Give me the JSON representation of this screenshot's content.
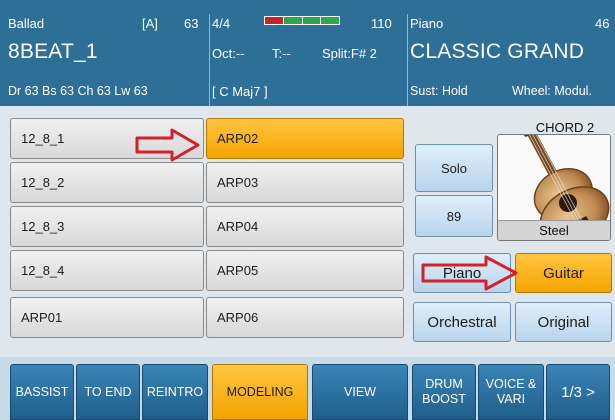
{
  "style_panel": {
    "category": "Ballad",
    "variation": "[A]",
    "number": "63",
    "name": "8BEAT_1",
    "volumes": "Dr 63  Bs 63  Ch 63  Lw 63"
  },
  "mid_panel": {
    "time_signature": "4/4",
    "tempo": "110",
    "octave": "Oct:--",
    "transpose": "T:--",
    "split": "Split:F# 2",
    "chord": "[ C Maj7 ]",
    "meter_colors": [
      "#c9232b",
      "#2aa84a",
      "#2aa84a",
      "#2aa84a"
    ]
  },
  "voice_panel": {
    "category": "Piano",
    "number": "46",
    "name": "CLASSIC GRAND",
    "sustain": "Sust: Hold",
    "wheel": "Wheel: Modul."
  },
  "grid": {
    "left": [
      "12_8_1",
      "12_8_2",
      "12_8_3",
      "12_8_4",
      "ARP01"
    ],
    "right": [
      "ARP02",
      "ARP03",
      "ARP04",
      "ARP05",
      "ARP06"
    ],
    "selected": "ARP02"
  },
  "right_panel": {
    "chord_title": "CHORD 2",
    "solo_label": "Solo",
    "value_label": "89",
    "instrument_label": "Steel",
    "cat_piano": "Piano",
    "cat_guitar": "Guitar",
    "cat_orchestral": "Orchestral",
    "cat_original": "Original",
    "selected_category": "Guitar"
  },
  "toolbar": {
    "bassist": "BASSIST",
    "to_end": "TO END",
    "reintro": "REINTRO",
    "modeling": "MODELING",
    "view": "VIEW",
    "drum_boost_1": "DRUM",
    "drum_boost_2": "BOOST",
    "voice_vari_1": "VOICE &",
    "voice_vari_2": "VARI",
    "page": "1/3 >"
  },
  "colors": {
    "header_bg": "#2d6f97",
    "selected_orange": "#f5a300",
    "arrow_red": "#d4202a"
  }
}
